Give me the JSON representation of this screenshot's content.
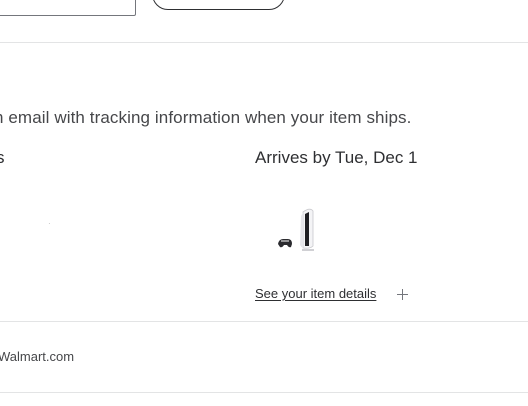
{
  "shipping": {
    "info_text": "n email with tracking information when your item ships.",
    "left_fragment": "s",
    "arrives": "Arrives by Tue, Dec 1",
    "see_details_link": "See your item details",
    "product_icon": "game-console-icon",
    "expand_icon": "plus-icon"
  },
  "footer": {
    "site_text": "Walmart.com"
  }
}
